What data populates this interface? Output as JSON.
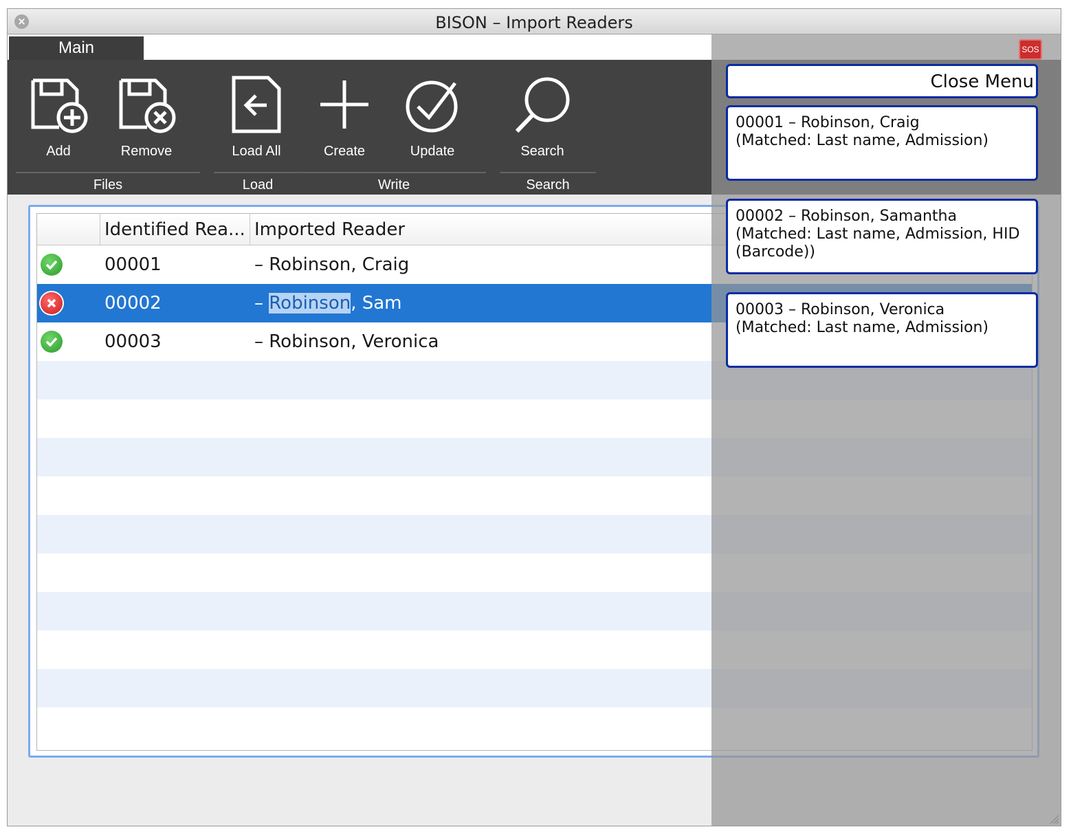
{
  "window": {
    "title": "BISON – Import Readers"
  },
  "tabs": [
    {
      "label": "Main"
    }
  ],
  "sos_label": "SOS",
  "ribbon": {
    "buttons": [
      {
        "id": "add",
        "label": "Add",
        "icon": "save-add-icon"
      },
      {
        "id": "remove",
        "label": "Remove",
        "icon": "save-remove-icon"
      },
      {
        "id": "load_all",
        "label": "Load All",
        "icon": "import-icon"
      },
      {
        "id": "create",
        "label": "Create",
        "icon": "plus-icon"
      },
      {
        "id": "update",
        "label": "Update",
        "icon": "check-circle-icon"
      },
      {
        "id": "search",
        "label": "Search",
        "icon": "search-icon"
      }
    ],
    "groups": [
      {
        "label": "Files"
      },
      {
        "label": "Load"
      },
      {
        "label": "Write"
      },
      {
        "label": "Search"
      }
    ]
  },
  "grid": {
    "columns": [
      {
        "label": ""
      },
      {
        "label": "Identified Rea..."
      },
      {
        "label": "Imported Reader"
      }
    ],
    "rows": [
      {
        "status": "matched",
        "identified": "00001",
        "imported_prefix": "– ",
        "imported_name": "Robinson",
        "imported_rest": ", Craig",
        "selected": false
      },
      {
        "status": "error",
        "identified": "00002",
        "imported_prefix": "– ",
        "imported_name": "Robinson",
        "imported_rest": ", Sam",
        "selected": true
      },
      {
        "status": "matched",
        "identified": "00003",
        "imported_prefix": "– ",
        "imported_name": "Robinson",
        "imported_rest": ", Veronica",
        "selected": false
      }
    ]
  },
  "side_menu": {
    "close_label": "Close Menu",
    "items": [
      {
        "line1": "00001 – Robinson, Craig",
        "line2": "(Matched: Last name, Admission)"
      },
      {
        "line1": "00002 – Robinson, Samantha",
        "line2": "(Matched: Last name, Admission, HID (Barcode))"
      },
      {
        "line1": "00003 – Robinson, Veronica",
        "line2": "(Matched: Last name, Admission)"
      }
    ]
  },
  "colors": {
    "ribbon_bg": "#424242",
    "selection": "#2277d2",
    "menu_border": "#0a2ba3",
    "grid_focus": "#7aaaf0"
  }
}
